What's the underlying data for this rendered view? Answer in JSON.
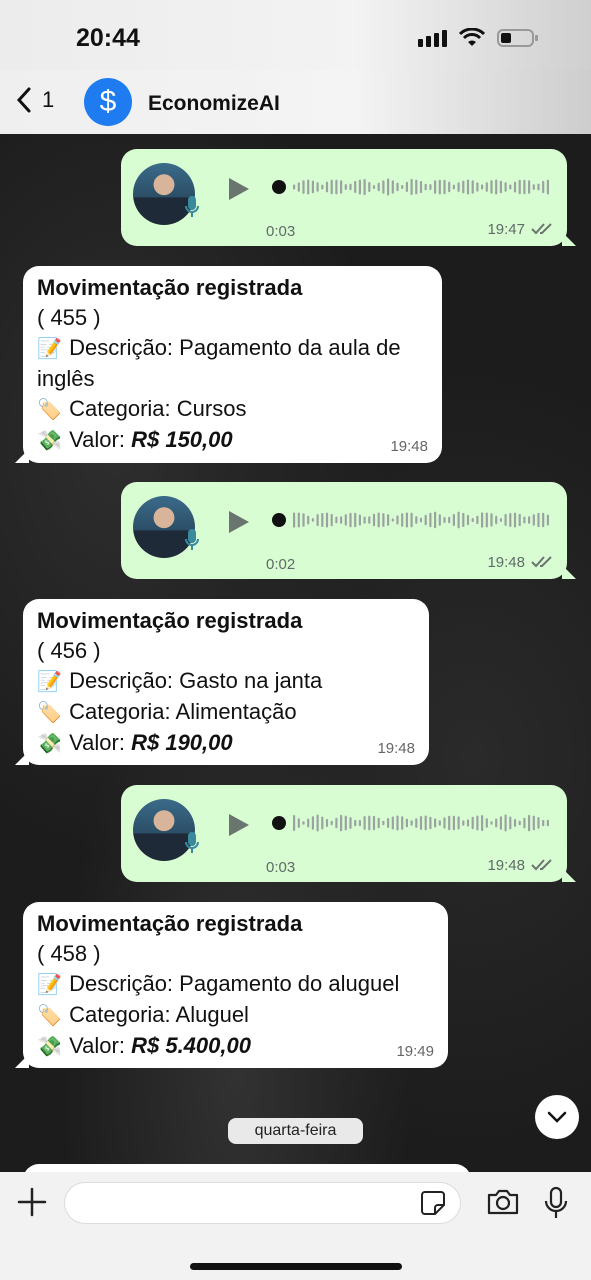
{
  "status": {
    "time": "20:44"
  },
  "header": {
    "back_count": "1",
    "contact_name": "EconomizeAI",
    "logo_symbol": "$"
  },
  "messages": [
    {
      "type": "voice",
      "duration": "0:03",
      "time": "19:47"
    },
    {
      "type": "text",
      "title": "Movimentação registrada",
      "id": "( 455 )",
      "description_label": "Descrição:",
      "description": "Pagamento da aula de inglês",
      "category_label": "Categoria:",
      "category": "Cursos",
      "value_label": "Valor:",
      "value": "R$ 150,00",
      "time": "19:48"
    },
    {
      "type": "voice",
      "duration": "0:02",
      "time": "19:48"
    },
    {
      "type": "text",
      "title": "Movimentação registrada",
      "id": "( 456 )",
      "description_label": "Descrição:",
      "description": "Gasto na janta",
      "category_label": "Categoria:",
      "category": "Alimentação",
      "value_label": "Valor:",
      "value": "R$ 190,00",
      "time": "19:48"
    },
    {
      "type": "voice",
      "duration": "0:03",
      "time": "19:48"
    },
    {
      "type": "text",
      "title": "Movimentação registrada",
      "id": "( 458 )",
      "description_label": "Descrição:",
      "description": "Pagamento do aluguel",
      "category_label": "Categoria:",
      "category": "Aluguel",
      "value_label": "Valor:",
      "value": "R$ 5.400,00",
      "time": "19:49"
    }
  ],
  "day_separator": "quarta-feira",
  "emojis": {
    "description": "📝",
    "category": "🏷️",
    "value": "💸"
  },
  "composer": {
    "placeholder": ""
  },
  "colors": {
    "outgoing_bubble": "#d9fdd3",
    "incoming_bubble": "#ffffff",
    "accent": "#1e7cf0"
  }
}
